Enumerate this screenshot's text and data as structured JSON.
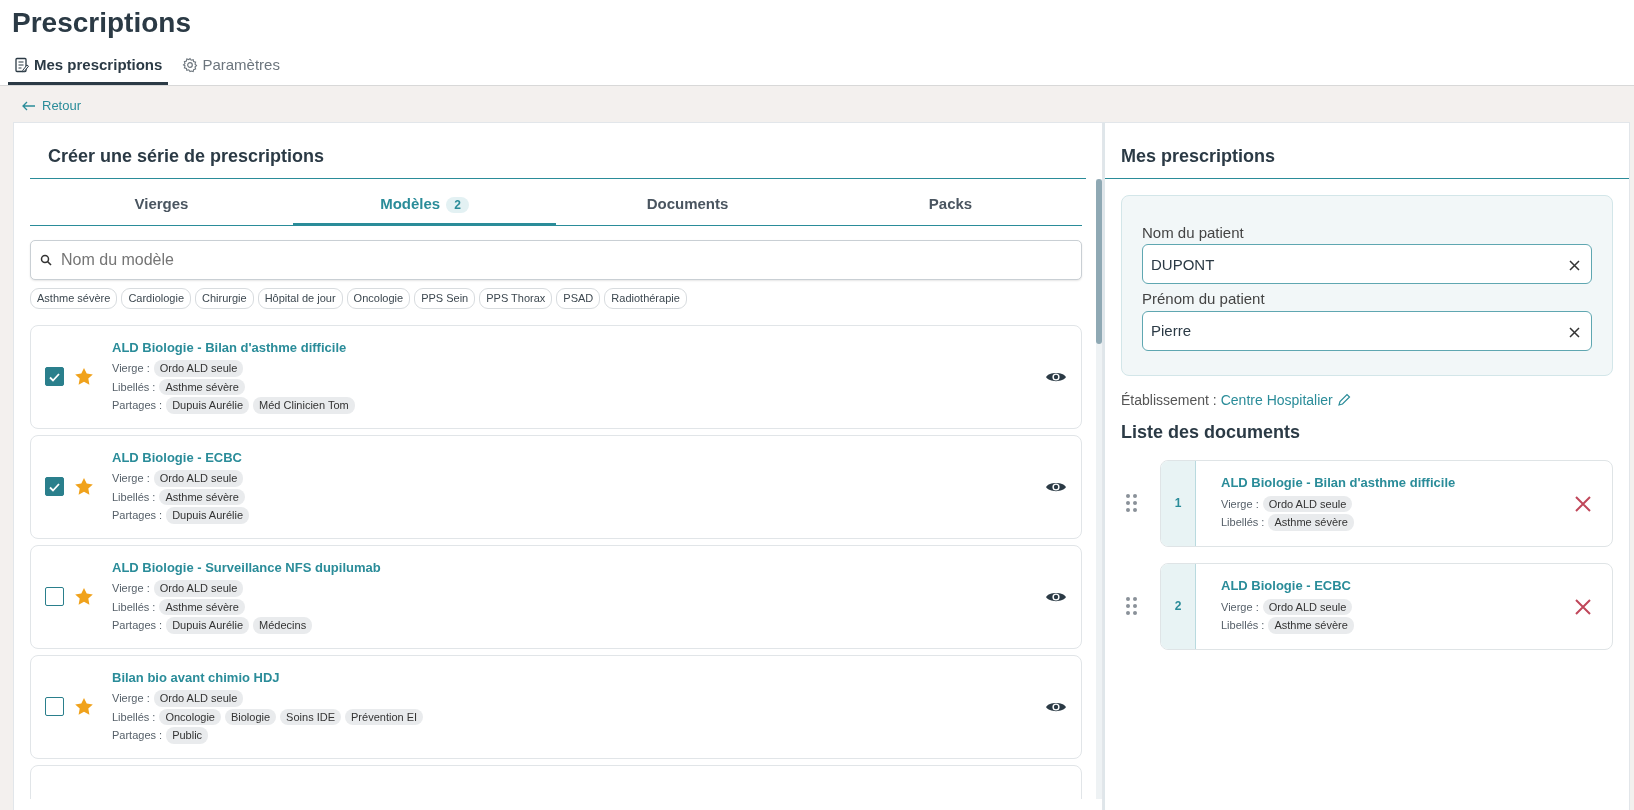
{
  "page": {
    "title": "Prescriptions"
  },
  "nav_tabs": [
    {
      "label": "Mes prescriptions",
      "selected": true
    },
    {
      "label": "Paramètres",
      "selected": false
    }
  ],
  "back_link": "Retour",
  "creator": {
    "title": "Créer une série de prescriptions",
    "tabs": [
      {
        "label": "Vierges",
        "selected": false
      },
      {
        "label": "Modèles",
        "count": "2",
        "selected": true
      },
      {
        "label": "Documents",
        "selected": false
      },
      {
        "label": "Packs",
        "selected": false
      }
    ],
    "search": {
      "placeholder": "Nom du modèle"
    },
    "filter_tags": [
      "Asthme sévère",
      "Cardiologie",
      "Chirurgie",
      "Hôpital de jour",
      "Oncologie",
      "PPS Sein",
      "PPS Thorax",
      "PSAD",
      "Radiothérapie"
    ],
    "models": [
      {
        "title": "ALD Biologie - Bilan d'asthme difficile",
        "checked": true,
        "fields": [
          {
            "label": "Vierge :",
            "chips": [
              "Ordo ALD seule"
            ]
          },
          {
            "label": "Libellés :",
            "chips": [
              "Asthme sévère"
            ]
          },
          {
            "label": "Partages :",
            "chips": [
              "Dupuis Aurélie",
              "Méd Clinicien Tom"
            ]
          }
        ]
      },
      {
        "title": "ALD Biologie - ECBC",
        "checked": true,
        "fields": [
          {
            "label": "Vierge :",
            "chips": [
              "Ordo ALD seule"
            ]
          },
          {
            "label": "Libellés :",
            "chips": [
              "Asthme sévère"
            ]
          },
          {
            "label": "Partages :",
            "chips": [
              "Dupuis Aurélie"
            ]
          }
        ]
      },
      {
        "title": "ALD Biologie - Surveillance NFS dupilumab",
        "checked": false,
        "fields": [
          {
            "label": "Vierge :",
            "chips": [
              "Ordo ALD seule"
            ]
          },
          {
            "label": "Libellés :",
            "chips": [
              "Asthme sévère"
            ]
          },
          {
            "label": "Partages :",
            "chips": [
              "Dupuis Aurélie",
              "Médecins"
            ]
          }
        ]
      },
      {
        "title": "Bilan bio avant chimio HDJ",
        "checked": false,
        "fields": [
          {
            "label": "Vierge :",
            "chips": [
              "Ordo ALD seule"
            ]
          },
          {
            "label": "Libellés :",
            "chips": [
              "Oncologie",
              "Biologie",
              "Soins IDE",
              "Prévention EI"
            ]
          },
          {
            "label": "Partages :",
            "chips": [
              "Public"
            ]
          }
        ]
      }
    ]
  },
  "summary": {
    "title": "Mes prescriptions",
    "patient_fields": [
      {
        "label": "Nom du patient",
        "value": "DUPONT"
      },
      {
        "label": "Prénom du patient",
        "value": "Pierre"
      }
    ],
    "establishment": {
      "label": "Établissement :",
      "value": "Centre Hospitalier"
    },
    "documents_title": "Liste des documents",
    "documents": [
      {
        "number": "1",
        "title": "ALD Biologie - Bilan d'asthme difficile",
        "fields": [
          {
            "label": "Vierge :",
            "chips": [
              "Ordo ALD seule"
            ]
          },
          {
            "label": "Libellés :",
            "chips": [
              "Asthme sévère"
            ]
          }
        ]
      },
      {
        "number": "2",
        "title": "ALD Biologie - ECBC",
        "fields": [
          {
            "label": "Vierge :",
            "chips": [
              "Ordo ALD seule"
            ]
          },
          {
            "label": "Libellés :",
            "chips": [
              "Asthme sévère"
            ]
          }
        ]
      }
    ]
  }
}
